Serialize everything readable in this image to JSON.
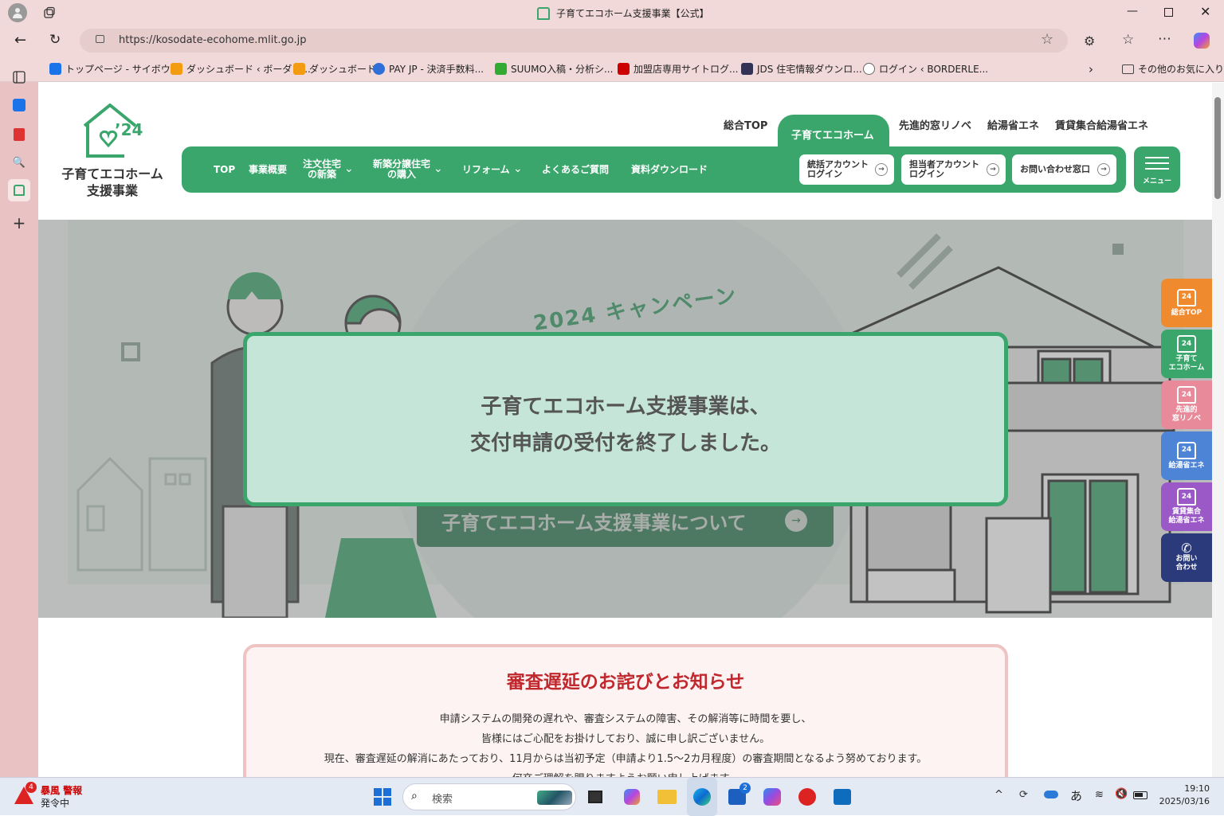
{
  "browser": {
    "tab_title": "子育てエコホーム支援事業【公式】",
    "url": "https://kosodate-ecohome.mlit.go.jp",
    "favorites": [
      {
        "label": "トップページ - サイボウ...",
        "color": "#1a73e8"
      },
      {
        "label": "ダッシュボード ‹ ボーダレ...",
        "color": "#f39c12"
      },
      {
        "label": "ダッシュボード",
        "color": "#f39c12"
      },
      {
        "label": "PAY JP - 決済手数料...",
        "color": "#2f6fd8"
      },
      {
        "label": "SUUMO入稿・分析シ...",
        "color": "#3a3"
      },
      {
        "label": "加盟店専用サイトログ...",
        "color": "#c00"
      },
      {
        "label": "JDS 住宅情報ダウンロ...",
        "color": "#335"
      },
      {
        "label": "ログイン ‹ BORDERLE...",
        "color": "#666"
      }
    ],
    "other_favorites": "その他のお気に入り"
  },
  "site": {
    "logo_line1": "子育てエコホーム",
    "logo_line2": "支援事業",
    "top_nav": [
      "総合TOP",
      "子育てエコホーム",
      "先進的窓リノベ",
      "給湯省エネ",
      "賃貸集合給湯省エネ"
    ],
    "global_nav": {
      "top": "TOP",
      "overview": "事業概要",
      "order_l1": "注文住宅",
      "order_l2": "の新築",
      "buy_l1": "新築分譲住宅",
      "buy_l2": "の購入",
      "reform": "リフォーム",
      "faq": "よくあるご質問",
      "download": "資料ダウンロード"
    },
    "account_buttons": {
      "unified_l1": "統括アカウント",
      "unified_l2": "ログイン",
      "staff_l1": "担当者アカウント",
      "staff_l2": "ログイン",
      "contact": "お問い合わせ窓口"
    },
    "menu_label": "メニュー",
    "hero": {
      "campaign": "2024 キャンペーン",
      "notice_line1": "子育てエコホーム支援事業は、",
      "notice_line2": "交付申請の受付を終了しました。",
      "about_button": "子育てエコホーム支援事業について"
    },
    "side_tabs": [
      {
        "l1": "総合TOP",
        "l2": "",
        "color": "#f08a2e"
      },
      {
        "l1": "子育て",
        "l2": "エコホーム",
        "color": "#3aaa6e"
      },
      {
        "l1": "先進的",
        "l2": "窓リノベ",
        "color": "#e98a9a"
      },
      {
        "l1": "給湯省エネ",
        "l2": "",
        "color": "#4d84d6"
      },
      {
        "l1": "賃貸集合",
        "l2": "給湯省エネ",
        "color": "#9b59c8"
      },
      {
        "l1": "お問い",
        "l2": "合わせ",
        "color": "#2b3a7a"
      }
    ],
    "apology": {
      "title": "審査遅延のお詫びとお知らせ",
      "lines": [
        "申請システムの開発の遅れや、審査システムの障害、その解消等に時間を要し、",
        "皆様にはご心配をお掛けしており、誠に申し訳ございません。",
        "現在、審査遅延の解消にあたっており、11月からは当初予定（申請より1.5〜2カ月程度）の審査期間となるよう努めております。",
        "何卒ご理解を賜りますようお願い申し上げます。"
      ]
    }
  },
  "taskbar": {
    "weather_badge": "4",
    "weather_line1": "暴風 警報",
    "weather_line2": "発令中",
    "search_placeholder": "検索",
    "store_badge": "2",
    "ime": "あ",
    "time": "19:10",
    "date": "2025/03/16"
  },
  "colors": {
    "brand_green": "#3aa66c",
    "notice_bg": "#c4e5d8",
    "apology_red": "#c0282d"
  }
}
